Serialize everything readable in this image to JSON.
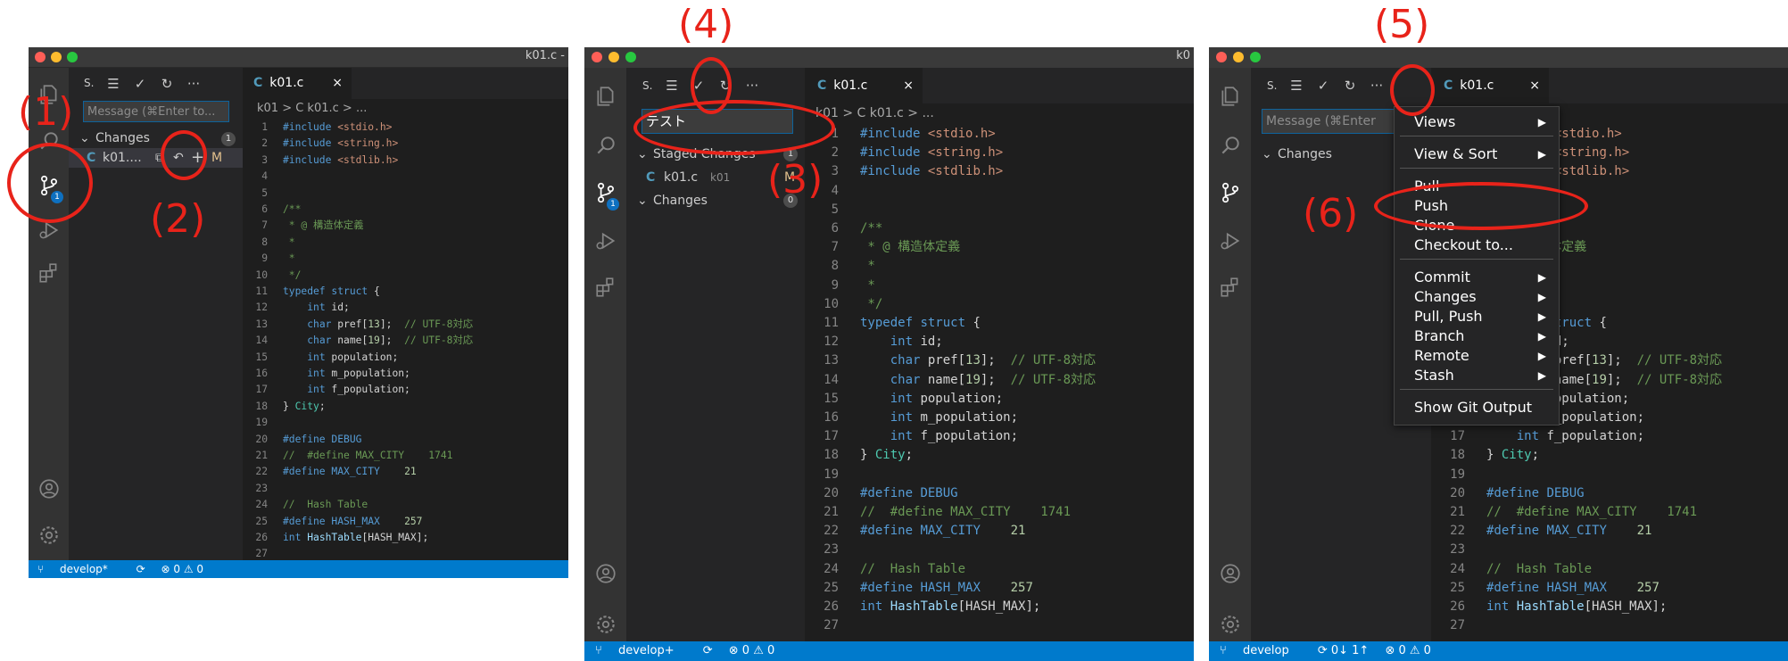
{
  "panels": [
    {
      "window_title": "k01.c -",
      "sidebar": {
        "header_short": "S.",
        "message_placeholder": "Message (⌘Enter to...",
        "changes_label": "Changes",
        "changes_count": "1",
        "file_label": "k01....",
        "file_status": "M"
      },
      "source_control_badge": "1",
      "tab_label": "k01.c",
      "breadcrumb": "k01 > C k01.c > ...",
      "status": {
        "branch": "develop*",
        "sync": "⟳",
        "problems": "⊗ 0 ⚠ 0"
      },
      "annotations": [
        "(1)",
        "(2)"
      ]
    },
    {
      "window_title": "k0",
      "sidebar": {
        "header_short": "S.",
        "message_value": "テスト",
        "staged_label": "Staged Changes",
        "staged_count": "1",
        "file_label": "k01.c",
        "file_folder": "k01",
        "file_status": "M",
        "changes_label": "Changes",
        "changes_count": "0"
      },
      "source_control_badge": "1",
      "tab_label": "k01.c",
      "breadcrumb": "k01 > C k01.c > ...",
      "status": {
        "branch": "develop+",
        "sync": "⟳",
        "problems": "⊗ 0 ⚠ 0"
      },
      "annotations": [
        "(4)",
        "(3)"
      ]
    },
    {
      "sidebar": {
        "header_short": "S.",
        "message_placeholder": "Message (⌘Enter",
        "changes_label": "Changes"
      },
      "tab_label": "k01.c",
      "status": {
        "branch": "develop",
        "sync": "⟳ 0↓ 1↑",
        "problems": "⊗ 0 ⚠ 0"
      },
      "annotations": [
        "(5)",
        "(6)"
      ],
      "more_menu": {
        "items": [
          "Views",
          "View & Sort",
          "Pull",
          "Push",
          "Clone",
          "Checkout to...",
          "Commit",
          "Changes",
          "Pull, Push",
          "Branch",
          "Remote",
          "Stash",
          "Show Git Output"
        ]
      }
    }
  ],
  "code_lines": [
    {
      "n": "1",
      "t": "#include <stdio.h>"
    },
    {
      "n": "2",
      "t": "#include <string.h>"
    },
    {
      "n": "3",
      "t": "#include <stdlib.h>"
    },
    {
      "n": "4",
      "t": ""
    },
    {
      "n": "5",
      "t": ""
    },
    {
      "n": "6",
      "t": "/**"
    },
    {
      "n": "7",
      "t": " * @ 構造体定義"
    },
    {
      "n": "8",
      "t": " *"
    },
    {
      "n": "9",
      "t": " *"
    },
    {
      "n": "10",
      "t": " */"
    },
    {
      "n": "11",
      "t": "typedef struct {"
    },
    {
      "n": "12",
      "t": "    int id;"
    },
    {
      "n": "13",
      "t": "    char pref[13];  // UTF-8対応"
    },
    {
      "n": "14",
      "t": "    char name[19];  // UTF-8対応"
    },
    {
      "n": "15",
      "t": "    int population;"
    },
    {
      "n": "16",
      "t": "    int m_population;"
    },
    {
      "n": "17",
      "t": "    int f_population;"
    },
    {
      "n": "18",
      "t": "} City;"
    },
    {
      "n": "19",
      "t": ""
    },
    {
      "n": "20",
      "t": "#define DEBUG"
    },
    {
      "n": "21",
      "t": "//  #define MAX_CITY    1741"
    },
    {
      "n": "22",
      "t": "#define MAX_CITY    21"
    },
    {
      "n": "23",
      "t": ""
    },
    {
      "n": "24",
      "t": "//  Hash Table"
    },
    {
      "n": "25",
      "t": "#define HASH_MAX    257"
    },
    {
      "n": "26",
      "t": "int HashTable[HASH_MAX];"
    },
    {
      "n": "27",
      "t": ""
    }
  ],
  "colors": {
    "editor_bg": "#1e1e1e",
    "sidebar_bg": "#252526",
    "activity_bg": "#333333",
    "statusbar_bg": "#007acc",
    "annotation_red": "#e8231a",
    "keyword": "#569cd6",
    "string": "#ce9178",
    "comment": "#6a9955"
  },
  "icons": [
    "explorer-icon",
    "search-icon",
    "source-control-icon",
    "run-debug-icon",
    "extensions-icon",
    "account-icon",
    "settings-gear-icon",
    "checkmark-icon",
    "refresh-icon",
    "more-icon",
    "tree-view-icon",
    "close-icon",
    "plus-icon",
    "discard-icon",
    "open-file-icon",
    "chevron-down-icon",
    "submenu-arrow-icon",
    "branch-icon",
    "sync-icon"
  ]
}
